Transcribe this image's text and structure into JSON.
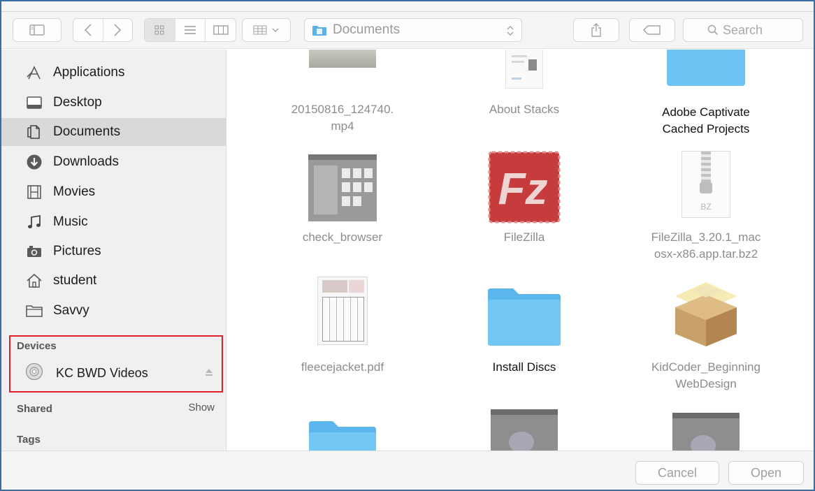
{
  "toolbar": {
    "path_label": "Documents",
    "search_placeholder": "Search"
  },
  "sidebar": {
    "favorites": [
      {
        "label": "Applications",
        "icon": "applications-icon"
      },
      {
        "label": "Desktop",
        "icon": "desktop-icon"
      },
      {
        "label": "Documents",
        "icon": "documents-icon",
        "selected": true
      },
      {
        "label": "Downloads",
        "icon": "downloads-icon"
      },
      {
        "label": "Movies",
        "icon": "movies-icon"
      },
      {
        "label": "Music",
        "icon": "music-icon"
      },
      {
        "label": "Pictures",
        "icon": "pictures-icon"
      },
      {
        "label": "student",
        "icon": "home-icon"
      },
      {
        "label": "Savvy",
        "icon": "folder-icon"
      }
    ],
    "devices_heading": "Devices",
    "device": {
      "label": "KC BWD Videos",
      "icon": "disc-icon"
    },
    "shared_heading": "Shared",
    "shared_show": "Show",
    "tags_heading": "Tags"
  },
  "files": [
    {
      "line1": "20150816_124740.",
      "line2": "mp4",
      "enabled": false
    },
    {
      "line1": "About Stacks",
      "line2": "",
      "enabled": false
    },
    {
      "line1": "Adobe Captivate",
      "line2": "Cached Projects",
      "enabled": true
    },
    {
      "line1": "check_browser",
      "line2": "",
      "enabled": false
    },
    {
      "line1": "FileZilla",
      "line2": "",
      "enabled": false
    },
    {
      "line1": "FileZilla_3.20.1_mac",
      "line2": "osx-x86.app.tar.bz2",
      "enabled": false
    },
    {
      "line1": "fleecejacket.pdf",
      "line2": "",
      "enabled": false
    },
    {
      "line1": "Install Discs",
      "line2": "",
      "enabled": true
    },
    {
      "line1": "KidCoder_Beginning",
      "line2": "WebDesign",
      "enabled": false
    }
  ],
  "archive_badge": "BZ",
  "footer": {
    "cancel_label": "Cancel",
    "open_label": "Open"
  },
  "colors": {
    "folder_blue": "#6cc4f3",
    "highlight_red": "#e0202a",
    "filezilla_red": "#bf2a2a"
  }
}
